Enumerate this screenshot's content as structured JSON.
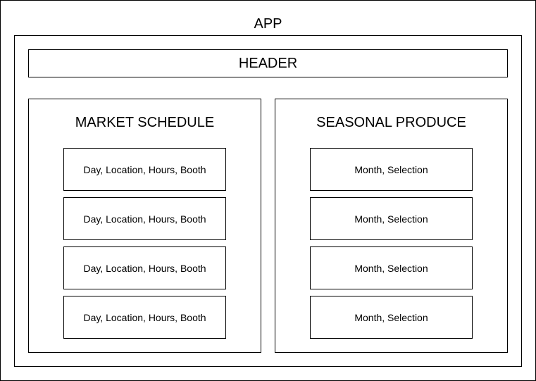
{
  "app": {
    "title": "APP"
  },
  "header": {
    "title": "HEADER"
  },
  "market_schedule": {
    "title": "MARKET SCHEDULE",
    "items": [
      "Day, Location, Hours, Booth",
      "Day, Location, Hours, Booth",
      "Day, Location, Hours, Booth",
      "Day, Location, Hours, Booth"
    ]
  },
  "seasonal_produce": {
    "title": "SEASONAL PRODUCE",
    "items": [
      "Month, Selection",
      "Month, Selection",
      "Month, Selection",
      "Month, Selection"
    ]
  }
}
